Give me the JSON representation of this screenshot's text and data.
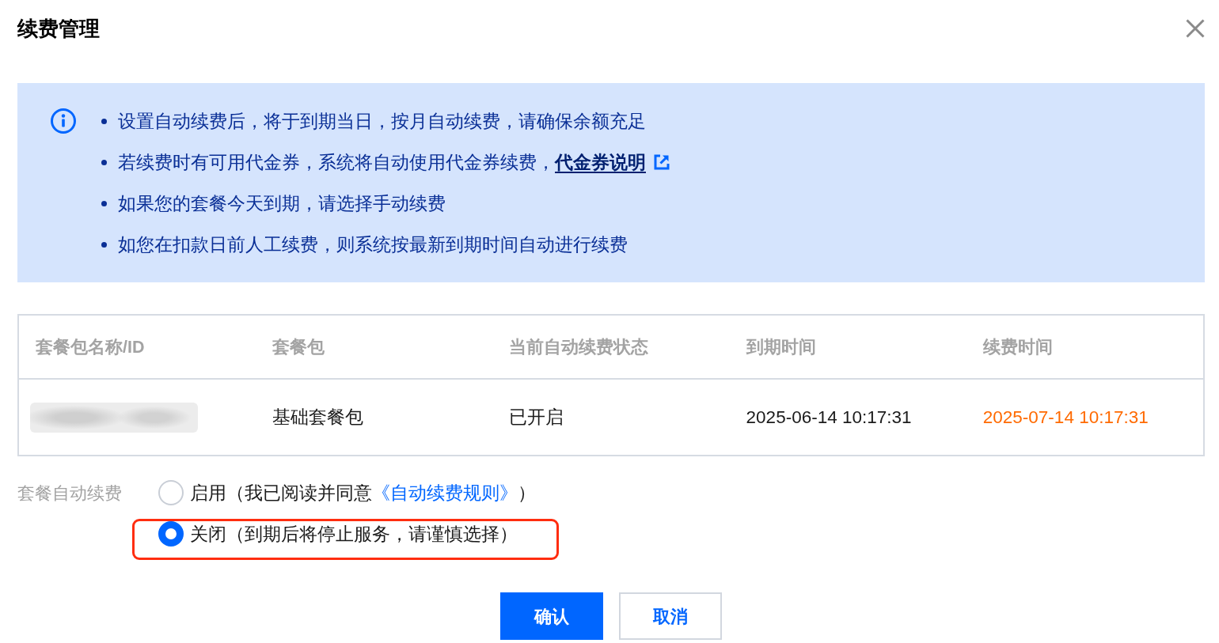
{
  "dialog": {
    "title": "续费管理"
  },
  "notice": {
    "items": [
      {
        "text": "设置自动续费后，将于到期当日，按月自动续费，请确保余额充足"
      },
      {
        "text": "若续费时有可用代金券，系统将自动使用代金券续费，",
        "link": "代金券说明"
      },
      {
        "text": "如果您的套餐今天到期，请选择手动续费"
      },
      {
        "text": "如您在扣款日前人工续费，则系统按最新到期时间自动进行续费"
      }
    ]
  },
  "table": {
    "columns": [
      "套餐包名称/ID",
      "套餐包",
      "当前自动续费状态",
      "到期时间",
      "续费时间"
    ],
    "rows": [
      {
        "cells": [
          {
            "kind": "blurred"
          },
          {
            "kind": "text",
            "text": "基础套餐包"
          },
          {
            "kind": "text",
            "text": "已开启"
          },
          {
            "kind": "text",
            "text": "2025-06-14 10:17:31"
          },
          {
            "kind": "accent",
            "text": "2025-07-14 10:17:31"
          }
        ]
      }
    ]
  },
  "auto_renew": {
    "label": "套餐自动续费",
    "options": [
      {
        "text": "启用（我已阅读并同意",
        "link": "《自动续费规则》",
        "suffix": "）",
        "selected": false,
        "highlighted": false
      },
      {
        "text": "关闭（到期后将停止服务，请谨慎选择）",
        "selected": true,
        "highlighted": true
      }
    ]
  },
  "buttons": [
    {
      "label": "确认",
      "kind": "primary"
    },
    {
      "label": "取消",
      "kind": "secondary"
    }
  ]
}
